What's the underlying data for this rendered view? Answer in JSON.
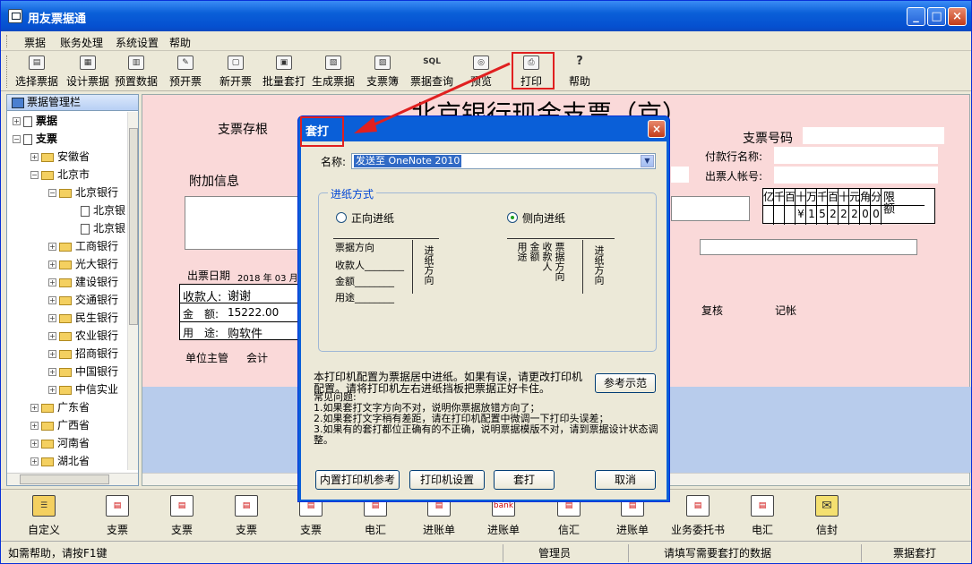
{
  "window": {
    "title": "用友票据通",
    "minimize": "_",
    "maximize": "□",
    "close": "×"
  },
  "menu": [
    "票据",
    "账务处理",
    "系统设置",
    "帮助"
  ],
  "toolbar": [
    {
      "label": "选择票据",
      "icon": "folder-open-icon",
      "sym": "▤"
    },
    {
      "label": "设计票据",
      "icon": "design-icon",
      "sym": "▦"
    },
    {
      "label": "预置数据",
      "icon": "preset-data-icon",
      "sym": "▥"
    },
    {
      "label": "预开票",
      "icon": "pre-invoice-icon",
      "sym": "✎"
    },
    {
      "label": "新开票",
      "icon": "new-invoice-icon",
      "sym": "▢"
    },
    {
      "label": "批量套打",
      "icon": "batch-print-icon",
      "sym": "▣"
    },
    {
      "label": "生成票据",
      "icon": "generate-icon",
      "sym": "▧"
    },
    {
      "label": "支票簿",
      "icon": "chequebook-icon",
      "sym": "▨"
    },
    {
      "label": "票据查询",
      "icon": "sql-query-icon",
      "sym": "SQL"
    },
    {
      "label": "预览",
      "icon": "preview-icon",
      "sym": "◎"
    },
    {
      "label": "打印",
      "icon": "printer-icon",
      "sym": "⎙"
    },
    {
      "label": "帮助",
      "icon": "help-icon",
      "sym": "?"
    }
  ],
  "left_panel": {
    "title": "票据管理栏",
    "tree": [
      "票据",
      "支票",
      "安徽省",
      "北京市",
      "北京银行",
      "北京银",
      "北京银",
      "工商银行",
      "光大银行",
      "建设银行",
      "交通银行",
      "民生银行",
      "农业银行",
      "招商银行",
      "中国银行",
      "中信实业",
      "广东省",
      "广西省",
      "河南省",
      "湖北省"
    ]
  },
  "cheque": {
    "title": "北京银行现金支票（京）",
    "stub": "支票存根",
    "extra_info": "附加信息",
    "cheque_no": "支票号码",
    "payer_bank": "付款行名称:",
    "drawer_account": "出票人帐号:",
    "issue_date_label": "出票日期",
    "issue_date_value": "2018 年 03 月",
    "payee_label": "收款人:",
    "payee_value": "谢谢",
    "amount_label": "金　额:",
    "amount_value": "15222.00",
    "purpose_label": "用　途:",
    "purpose_value": "购软件",
    "supervisor": "单位主管",
    "accountant": "会计",
    "reviewer": "复核",
    "bookkeeper": "记帐",
    "amount_headers": [
      "亿",
      "千",
      "百",
      "十",
      "万",
      "千",
      "百",
      "十",
      "元",
      "角",
      "分"
    ],
    "amount_digits": [
      "",
      "",
      "",
      "¥",
      "1",
      "5",
      "2",
      "2",
      "2",
      "0",
      "0"
    ],
    "limit_label": "限额"
  },
  "dialog": {
    "title": "套打",
    "close": "×",
    "name_label": "名称:",
    "name_value": "发送至 OneNote 2010",
    "feed_group": "进纸方式",
    "option_front": "正向进纸",
    "option_side": "侧向进纸",
    "diag_front": {
      "dir": "票据方向",
      "payee": "收款人________",
      "amount": "金额________",
      "purpose": "用途________",
      "feed": "进纸方向"
    },
    "diag_side": {
      "dir": "票据方向",
      "payee": "收款人",
      "amount": "金额",
      "purpose": "用途",
      "feed": "进纸方向"
    },
    "note": "本打印机配置为票据居中进纸。如果有误，请更改打印机配置。请将打印机左右进纸挡板把票据正好卡住。",
    "ref_button": "参考示范",
    "faq_title": "常见问题:",
    "faq": [
      "1.如果套打文字方向不对，说明你票据放错方向了；",
      "2.如果套打文字稍有差距，请在打印机配置中微调一下打印头误差；",
      "3.如果有的套打都位正确有的不正确，说明票据模版不对，请到票据设计状态调整。"
    ],
    "buttons": [
      "内置打印机参考",
      "打印机设置",
      "套打",
      "取消"
    ]
  },
  "bottom_bar": [
    {
      "label": "自定义",
      "icon": "custom-icon",
      "sym": "☰"
    },
    {
      "label": "支票",
      "icon": "cheque-icon",
      "sym": "▤"
    },
    {
      "label": "支票",
      "icon": "cheque-icon",
      "sym": "▤"
    },
    {
      "label": "支票",
      "icon": "cheque-icon",
      "sym": "▤"
    },
    {
      "label": "支票",
      "icon": "cheque-icon",
      "sym": "▤"
    },
    {
      "label": "电汇",
      "icon": "wire-icon",
      "sym": "▤"
    },
    {
      "label": "进账单",
      "icon": "deposit-icon",
      "sym": "▤"
    },
    {
      "label": "进账单",
      "icon": "deposit-bank-icon",
      "sym": "bank"
    },
    {
      "label": "信汇",
      "icon": "mail-transfer-icon",
      "sym": "▤"
    },
    {
      "label": "进账单",
      "icon": "deposit-icon",
      "sym": "▤"
    },
    {
      "label": "业务委托书",
      "icon": "entrust-icon",
      "sym": "▤"
    },
    {
      "label": "电汇",
      "icon": "wire-icon",
      "sym": "▤"
    },
    {
      "label": "信封",
      "icon": "envelope-icon",
      "sym": "✉"
    }
  ],
  "status": {
    "help": "如需帮助，请按F1键",
    "user": "管理员",
    "hint": "请填写需要套打的数据",
    "mode": "票据套打"
  }
}
